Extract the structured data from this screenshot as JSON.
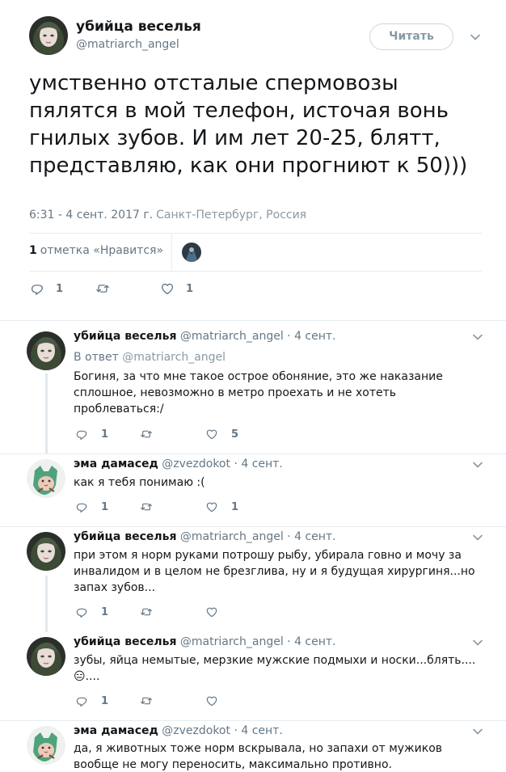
{
  "main_tweet": {
    "display_name": "убийца веселья",
    "handle": "@matriarch_angel",
    "follow_label": "Читать",
    "text": "умственно отсталые спермовозы пялятся в мой телефон, источая вонь гнилых зубов. И им лет 20-25, блятт, представляю, как они прогниют к 50)))",
    "timestamp": "6:31 - 4 сент. 2017 г.",
    "location": "Санкт-Петербург, Россия",
    "likes_count": "1",
    "likes_label": "отметка «Нравится»",
    "reply_count": "1",
    "retweet_count": "",
    "like_count": "1"
  },
  "replies": [
    {
      "display_name": "убийца веселья",
      "handle": "@matriarch_angel",
      "dot_time": "· 4 сент.",
      "reply_to_label": "В ответ",
      "reply_to_handle": "@matriarch_angel",
      "text": "Богиня, за что мне такое острое обоняние, это же наказание сплошное, невозможно в метро проехать и не хотеть проблеваться:/",
      "reply_count": "1",
      "retweet_count": "",
      "like_count": "5",
      "avatar": "girl"
    },
    {
      "display_name": "эма дамасед",
      "handle": "@zvezdokot",
      "dot_time": "· 4 сент.",
      "text": "как я тебя понимаю :(",
      "reply_count": "1",
      "retweet_count": "",
      "like_count": "1",
      "avatar": "cat"
    },
    {
      "display_name": "убийца веселья",
      "handle": "@matriarch_angel",
      "dot_time": "· 4 сент.",
      "text": "при этом я норм руками потрошу рыбу, убирала говно и мочу за инвалидом и в целом не брезглива, ну и я будущая хирургиня...но запах зубов...",
      "reply_count": "1",
      "retweet_count": "",
      "like_count": "",
      "avatar": "girl"
    },
    {
      "display_name": "убийца веселья",
      "handle": "@matriarch_angel",
      "dot_time": "· 4 сент.",
      "text": "зубы, яйца немытые, мерзкие мужские подмыхи и носки...блять....",
      "text_suffix": "....",
      "emoji": "😑",
      "reply_count": "1",
      "retweet_count": "",
      "like_count": "",
      "avatar": "girl"
    },
    {
      "display_name": "эма дамасед",
      "handle": "@zvezdokot",
      "dot_time": "· 4 сент.",
      "text": "да, я животных тоже норм вскрывала, но запахи от мужиков вообще не могу переносить, максимально противно.",
      "avatar": "cat"
    }
  ],
  "icons": {
    "reply": "reply-icon",
    "retweet": "retweet-icon",
    "like": "heart-icon",
    "caret": "chevron-down-icon"
  },
  "colors": {
    "text": "#14171a",
    "muted": "#657786",
    "border": "#e6ecf0"
  }
}
